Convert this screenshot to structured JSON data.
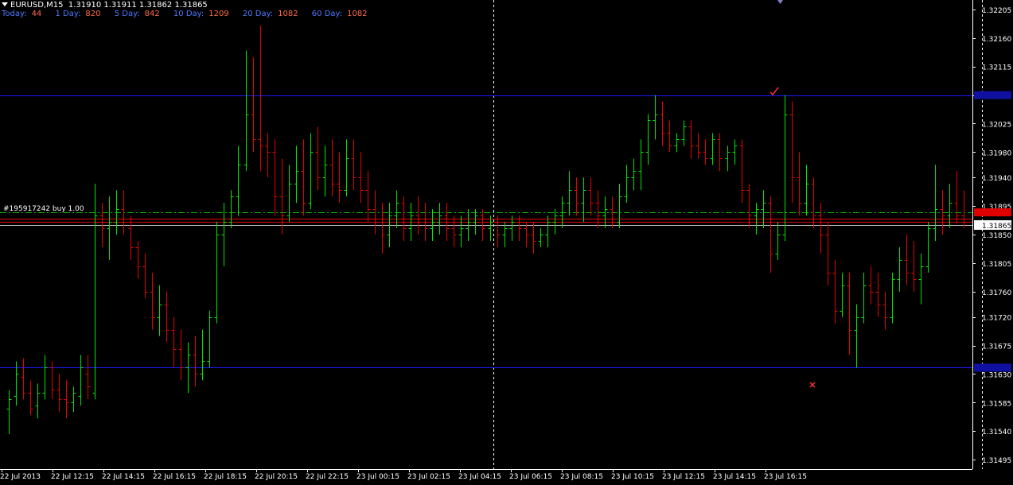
{
  "header": {
    "symbol": "EURUSD,M15",
    "ohlc": "1.31910 1.31911 1.31862 1.31865"
  },
  "stats": [
    {
      "label": "Today:",
      "value": "44"
    },
    {
      "label": "1 Day:",
      "value": "820"
    },
    {
      "label": "5 Day:",
      "value": "842"
    },
    {
      "label": "10 Day:",
      "value": "1209"
    },
    {
      "label": "20 Day:",
      "value": "1082"
    },
    {
      "label": "60 Day:",
      "value": "1082"
    }
  ],
  "order_label": "#195917242 buy 1.00",
  "current_price_label": "1.31865",
  "colors": {
    "background": "#000000",
    "bull": "#00e600",
    "bear": "#e60000",
    "hline": "#1a1aff",
    "grid": "#ffffff",
    "entry": "#00c000",
    "axis_text": "#ffffff",
    "price_box": "#ffffff",
    "price_box_text": "#000000",
    "red_box": "#e00000",
    "blue_box": "#1010a0"
  },
  "chart_data": {
    "type": "ohlc_bar",
    "symbol": "EURUSD",
    "timeframe": "M15",
    "y_ticks": [
      "1.32205",
      "1.32160",
      "1.32115",
      "1.32070",
      "1.32025",
      "1.31980",
      "1.31940",
      "1.31895",
      "1.31850",
      "1.31805",
      "1.31760",
      "1.31720",
      "1.31675",
      "1.31630",
      "1.31585",
      "1.31540",
      "1.31495"
    ],
    "x_ticks": [
      "22 Jul 2013",
      "22 Jul 12:15",
      "22 Jul 14:15",
      "22 Jul 16:15",
      "22 Jul 18:15",
      "22 Jul 20:15",
      "22 Jul 22:15",
      "23 Jul 00:15",
      "23 Jul 02:15",
      "23 Jul 04:15",
      "23 Jul 06:15",
      "23 Jul 08:15",
      "23 Jul 10:15",
      "23 Jul 12:15",
      "23 Jul 14:15",
      "23 Jul 16:15"
    ],
    "ylim": [
      1.3148,
      1.3222
    ],
    "horizontal_lines": [
      {
        "name": "resistance",
        "price": 1.3207,
        "style": "solid"
      },
      {
        "name": "support",
        "price": 1.3164,
        "style": "solid"
      },
      {
        "name": "entry",
        "price": 1.31885,
        "style": "dashdot"
      },
      {
        "name": "current",
        "price": 1.31865,
        "style": "solid"
      }
    ],
    "bars": [
      [
        1.31575,
        1.31605,
        1.31535,
        1.3159
      ],
      [
        1.31595,
        1.3165,
        1.3158,
        1.3163
      ],
      [
        1.31625,
        1.31655,
        1.3159,
        1.316
      ],
      [
        1.316,
        1.3162,
        1.31565,
        1.31575
      ],
      [
        1.3158,
        1.31615,
        1.3156,
        1.316
      ],
      [
        1.316,
        1.3166,
        1.3159,
        1.3164
      ],
      [
        1.3164,
        1.3165,
        1.3159,
        1.31605
      ],
      [
        1.31605,
        1.3163,
        1.3157,
        1.3159
      ],
      [
        1.3159,
        1.3162,
        1.3156,
        1.31585
      ],
      [
        1.31585,
        1.3161,
        1.3157,
        1.316
      ],
      [
        1.31595,
        1.3166,
        1.3158,
        1.3164
      ],
      [
        1.3163,
        1.3166,
        1.3159,
        1.3161
      ],
      [
        1.316,
        1.3193,
        1.3159,
        1.3188
      ],
      [
        1.3188,
        1.319,
        1.3183,
        1.3186
      ],
      [
        1.3186,
        1.3191,
        1.3181,
        1.3187
      ],
      [
        1.3187,
        1.3192,
        1.3185,
        1.3189
      ],
      [
        1.3189,
        1.3192,
        1.3185,
        1.3187
      ],
      [
        1.3186,
        1.3188,
        1.3181,
        1.3183
      ],
      [
        1.3183,
        1.3184,
        1.3178,
        1.318
      ],
      [
        1.318,
        1.3182,
        1.3175,
        1.3176
      ],
      [
        1.3176,
        1.3179,
        1.317,
        1.3172
      ],
      [
        1.3172,
        1.3177,
        1.3169,
        1.3174
      ],
      [
        1.3174,
        1.3176,
        1.3168,
        1.317
      ],
      [
        1.317,
        1.3172,
        1.3164,
        1.3167
      ],
      [
        1.3167,
        1.317,
        1.3162,
        1.3164
      ],
      [
        1.3164,
        1.3168,
        1.316,
        1.3166
      ],
      [
        1.3166,
        1.3169,
        1.3161,
        1.3163
      ],
      [
        1.3163,
        1.317,
        1.3162,
        1.3165
      ],
      [
        1.3165,
        1.3173,
        1.3164,
        1.3172
      ],
      [
        1.3172,
        1.3187,
        1.3171,
        1.3185
      ],
      [
        1.3185,
        1.319,
        1.318,
        1.3187
      ],
      [
        1.3187,
        1.3192,
        1.3186,
        1.3191
      ],
      [
        1.3191,
        1.3199,
        1.3188,
        1.3196
      ],
      [
        1.3196,
        1.3214,
        1.3195,
        1.3204
      ],
      [
        1.3204,
        1.3213,
        1.3198,
        1.32
      ],
      [
        1.32,
        1.3218,
        1.3195,
        1.3199
      ],
      [
        1.3199,
        1.3201,
        1.3194,
        1.3198
      ],
      [
        1.3198,
        1.32,
        1.3188,
        1.3191
      ],
      [
        1.3191,
        1.3197,
        1.3185,
        1.3188
      ],
      [
        1.3188,
        1.3196,
        1.3187,
        1.3193
      ],
      [
        1.3193,
        1.3199,
        1.319,
        1.3195
      ],
      [
        1.3195,
        1.32,
        1.3188,
        1.319
      ],
      [
        1.319,
        1.3201,
        1.3189,
        1.3198
      ],
      [
        1.3198,
        1.3202,
        1.3192,
        1.3194
      ],
      [
        1.3194,
        1.3199,
        1.3191,
        1.3196
      ],
      [
        1.3196,
        1.32,
        1.3191,
        1.3193
      ],
      [
        1.3193,
        1.3198,
        1.319,
        1.3192
      ],
      [
        1.3192,
        1.32,
        1.3191,
        1.3197
      ],
      [
        1.3197,
        1.32,
        1.3192,
        1.3194
      ],
      [
        1.3194,
        1.3198,
        1.319,
        1.3192
      ],
      [
        1.3192,
        1.3195,
        1.3187,
        1.3189
      ],
      [
        1.3189,
        1.3192,
        1.3185,
        1.3187
      ],
      [
        1.3187,
        1.319,
        1.3182,
        1.3185
      ],
      [
        1.3185,
        1.319,
        1.3183,
        1.3188
      ],
      [
        1.3188,
        1.3192,
        1.3186,
        1.319
      ],
      [
        1.319,
        1.3191,
        1.3184,
        1.3186
      ],
      [
        1.3186,
        1.319,
        1.3184,
        1.3188
      ],
      [
        1.3188,
        1.3191,
        1.3185,
        1.3187
      ],
      [
        1.3187,
        1.319,
        1.3184,
        1.3186
      ],
      [
        1.3186,
        1.3189,
        1.3184,
        1.3187
      ],
      [
        1.3187,
        1.319,
        1.3185,
        1.3188
      ],
      [
        1.3188,
        1.319,
        1.3184,
        1.3186
      ],
      [
        1.3186,
        1.3188,
        1.3183,
        1.3185
      ],
      [
        1.3185,
        1.3188,
        1.3183,
        1.3186
      ],
      [
        1.3186,
        1.3189,
        1.3184,
        1.3187
      ],
      [
        1.3187,
        1.3189,
        1.3185,
        1.3188
      ],
      [
        1.3188,
        1.3189,
        1.3184,
        1.3186
      ],
      [
        1.3186,
        1.3188,
        1.3184,
        1.3187
      ],
      [
        1.3187,
        1.3188,
        1.3183,
        1.3185
      ],
      [
        1.3185,
        1.3187,
        1.3183,
        1.3186
      ],
      [
        1.3186,
        1.3188,
        1.3184,
        1.3187
      ],
      [
        1.3187,
        1.3188,
        1.3184,
        1.3186
      ],
      [
        1.3186,
        1.3187,
        1.3183,
        1.3185
      ],
      [
        1.3185,
        1.3187,
        1.3182,
        1.3184
      ],
      [
        1.3184,
        1.3186,
        1.3183,
        1.3185
      ],
      [
        1.3185,
        1.3188,
        1.3183,
        1.3187
      ],
      [
        1.3187,
        1.3189,
        1.3185,
        1.3188
      ],
      [
        1.3188,
        1.3191,
        1.3186,
        1.319
      ],
      [
        1.319,
        1.3195,
        1.3188,
        1.3192
      ],
      [
        1.3192,
        1.3194,
        1.3188,
        1.319
      ],
      [
        1.319,
        1.3194,
        1.3187,
        1.3192
      ],
      [
        1.3192,
        1.3194,
        1.3188,
        1.319
      ],
      [
        1.319,
        1.3192,
        1.3186,
        1.3188
      ],
      [
        1.3188,
        1.3191,
        1.3186,
        1.3189
      ],
      [
        1.3189,
        1.3191,
        1.3186,
        1.3187
      ],
      [
        1.3187,
        1.3193,
        1.3186,
        1.3191
      ],
      [
        1.3191,
        1.3196,
        1.319,
        1.3194
      ],
      [
        1.3194,
        1.3197,
        1.3192,
        1.3195
      ],
      [
        1.3195,
        1.32,
        1.3192,
        1.3198
      ],
      [
        1.3198,
        1.3204,
        1.3196,
        1.3203
      ],
      [
        1.3203,
        1.3207,
        1.32,
        1.3204
      ],
      [
        1.3204,
        1.3206,
        1.3199,
        1.3201
      ],
      [
        1.3201,
        1.3203,
        1.3198,
        1.3199
      ],
      [
        1.3199,
        1.3201,
        1.3198,
        1.32
      ],
      [
        1.32,
        1.3203,
        1.3199,
        1.3202
      ],
      [
        1.3202,
        1.3203,
        1.3197,
        1.3199
      ],
      [
        1.3199,
        1.3201,
        1.3197,
        1.3198
      ],
      [
        1.3198,
        1.32,
        1.3196,
        1.3197
      ],
      [
        1.3197,
        1.3201,
        1.3196,
        1.32
      ],
      [
        1.32,
        1.3201,
        1.3195,
        1.3197
      ],
      [
        1.3197,
        1.3199,
        1.3195,
        1.3198
      ],
      [
        1.3198,
        1.32,
        1.3196,
        1.3199
      ],
      [
        1.3199,
        1.32,
        1.319,
        1.3192
      ],
      [
        1.3192,
        1.3193,
        1.3186,
        1.3188
      ],
      [
        1.3188,
        1.319,
        1.3185,
        1.3189
      ],
      [
        1.3189,
        1.3192,
        1.3186,
        1.319
      ],
      [
        1.319,
        1.3191,
        1.3179,
        1.3182
      ],
      [
        1.3182,
        1.3187,
        1.3181,
        1.3185
      ],
      [
        1.3185,
        1.3207,
        1.3184,
        1.3204
      ],
      [
        1.3204,
        1.3206,
        1.319,
        1.3194
      ],
      [
        1.3194,
        1.3198,
        1.3188,
        1.319
      ],
      [
        1.319,
        1.3196,
        1.3188,
        1.3193
      ],
      [
        1.3193,
        1.3194,
        1.3186,
        1.3188
      ],
      [
        1.3188,
        1.319,
        1.3182,
        1.3185
      ],
      [
        1.3185,
        1.3187,
        1.3177,
        1.3179
      ],
      [
        1.3179,
        1.3181,
        1.3171,
        1.3173
      ],
      [
        1.3173,
        1.3179,
        1.3172,
        1.3177
      ],
      [
        1.3177,
        1.3179,
        1.3166,
        1.317
      ],
      [
        1.317,
        1.3174,
        1.3164,
        1.3172
      ],
      [
        1.3172,
        1.3179,
        1.3171,
        1.3177
      ],
      [
        1.3177,
        1.318,
        1.3174,
        1.3176
      ],
      [
        1.3176,
        1.3179,
        1.3172,
        1.3174
      ],
      [
        1.3174,
        1.3176,
        1.317,
        1.3172
      ],
      [
        1.3172,
        1.3179,
        1.3171,
        1.3178
      ],
      [
        1.3178,
        1.3183,
        1.3176,
        1.3181
      ],
      [
        1.3181,
        1.3185,
        1.3177,
        1.3179
      ],
      [
        1.3179,
        1.3184,
        1.3176,
        1.3178
      ],
      [
        1.3178,
        1.3182,
        1.3174,
        1.318
      ],
      [
        1.318,
        1.3187,
        1.3179,
        1.3186
      ],
      [
        1.3186,
        1.3196,
        1.3184,
        1.3189
      ],
      [
        1.3189,
        1.3192,
        1.3185,
        1.3188
      ],
      [
        1.3188,
        1.3193,
        1.3186,
        1.319
      ],
      [
        1.319,
        1.3195,
        1.3187,
        1.3188
      ],
      [
        1.3188,
        1.3192,
        1.3186,
        1.3187
      ]
    ]
  }
}
